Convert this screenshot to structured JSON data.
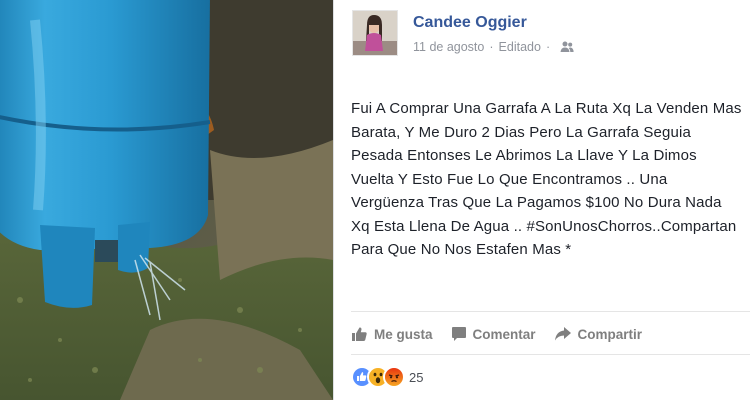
{
  "post": {
    "author": "Candee Oggier",
    "date": "11 de agosto",
    "separator": "·",
    "edited": "Editado",
    "text": "Fui A Comprar Una Garrafa A La Ruta Xq La Venden Mas Barata, Y Me Duro 2 Dias Pero La Garrafa Seguia Pesada Entonses Le Abrimos La Llave Y La Dimos Vuelta Y Esto Fue Lo Que Encontramos .. Una Vergüenza Tras Que La Pagamos $100 No Dura Nada Xq Esta Llena De Agua .. #SonUnosChorros..Compartan Para Que No Nos Estafen Mas *",
    "audience_icon": "friends-icon"
  },
  "actions": {
    "like_label": "Me gusta",
    "comment_label": "Comentar",
    "share_label": "Compartir"
  },
  "reactions": {
    "types": [
      "like",
      "wow",
      "angry"
    ],
    "count": "25"
  },
  "colors": {
    "author": "#365899",
    "meta": "#90949c",
    "text": "#1d2129",
    "action": "#7f7f7f",
    "like_blue": "#5890ff",
    "wow_yellow": "#f7b125",
    "angry_red": "#e9710f"
  }
}
